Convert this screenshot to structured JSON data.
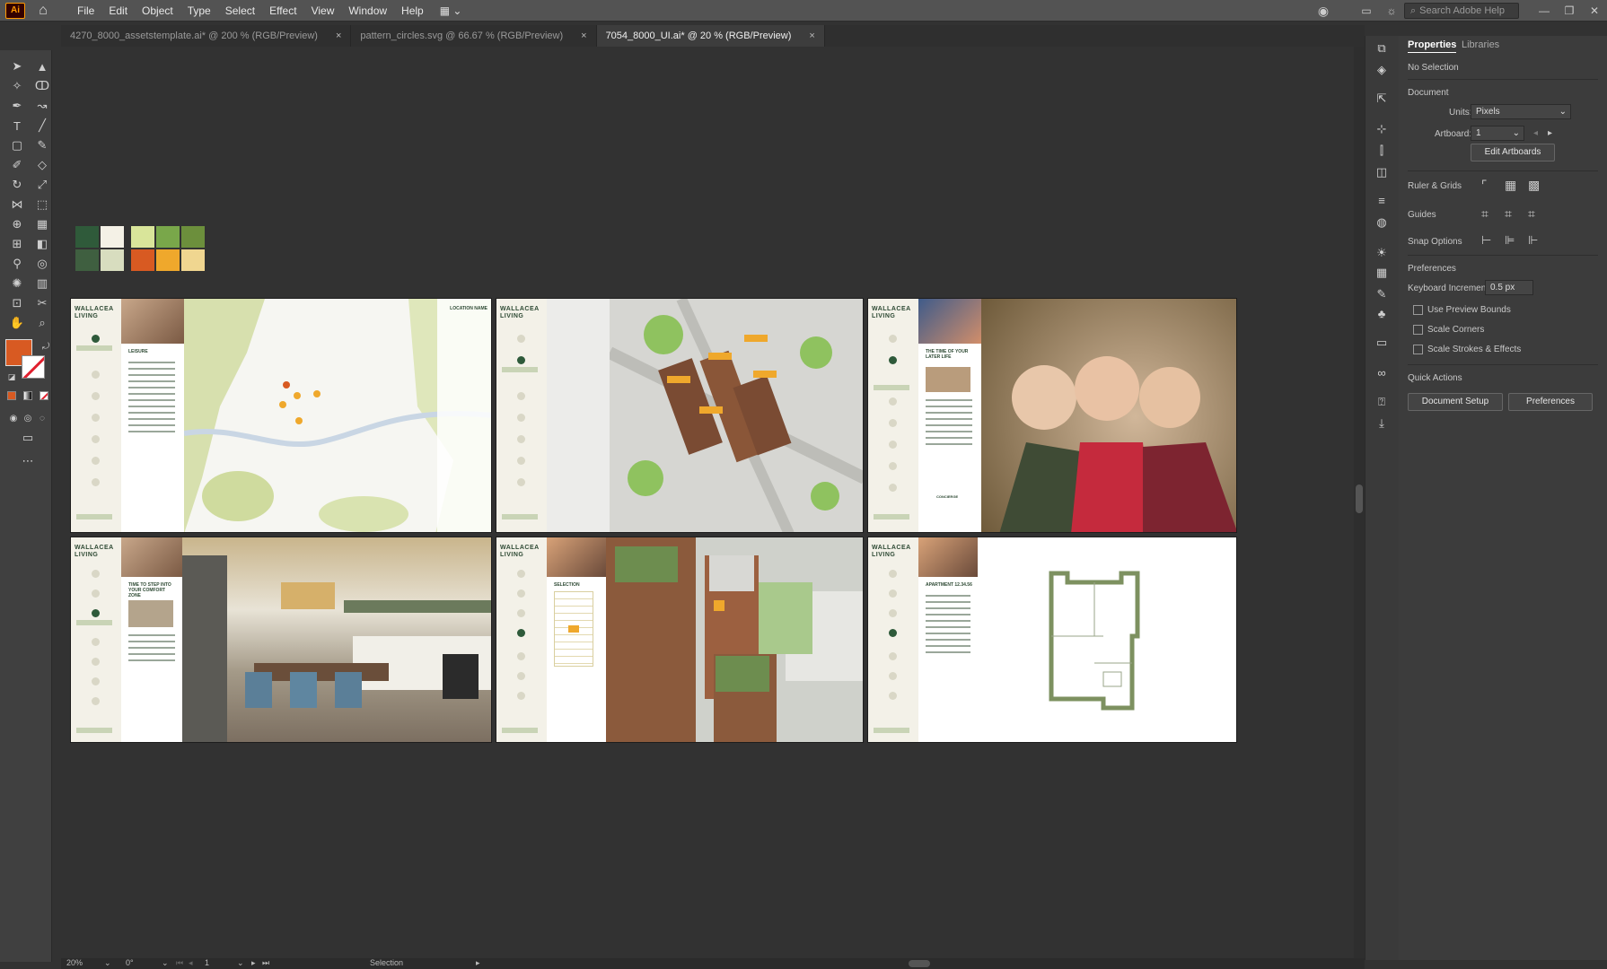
{
  "app": {
    "logo": "Ai",
    "workspace_icon": "▦ ⌄"
  },
  "menu": [
    "File",
    "Edit",
    "Object",
    "Type",
    "Select",
    "Effect",
    "View",
    "Window",
    "Help"
  ],
  "search": {
    "placeholder": "Search Adobe Help"
  },
  "tabs": [
    {
      "label": "4270_8000_assetstemplate.ai* @ 200 % (RGB/Preview)",
      "close": "×"
    },
    {
      "label": "pattern_circles.svg @ 66.67 % (RGB/Preview)",
      "close": "×"
    },
    {
      "label": "7054_8000_UI.ai* @ 20 % (RGB/Preview)",
      "close": "×"
    }
  ],
  "swatches": [
    "#2f5a3a",
    "#f4f1e6",
    "#d9e59a",
    "#79a74a",
    "#6c8f3c",
    "#3f5f40",
    "#d8ddbf",
    "#d85a22",
    "#efa82c",
    "#f0d690"
  ],
  "brand": {
    "logo_line1": "WALLACEA",
    "logo_line2": "LIVING"
  },
  "artboards": [
    {
      "heading": "LEISURE",
      "panel_title": "LOCATION NAME",
      "kind": "map"
    },
    {
      "heading": "",
      "kind": "aerial"
    },
    {
      "heading": "THE TIME OF YOUR LATER LIFE",
      "kind": "photo",
      "footer": "CONCIERGE"
    },
    {
      "heading": "TIME TO STEP INTO YOUR COMFORT ZONE",
      "kind": "kitchen"
    },
    {
      "heading": "SELECTION",
      "kind": "building"
    },
    {
      "heading": "APARTMENT 12.34.56",
      "kind": "floorplan"
    }
  ],
  "properties": {
    "tab_properties": "Properties",
    "tab_libraries": "Libraries",
    "no_selection": "No Selection",
    "document": "Document",
    "units_label": "Units:",
    "units_value": "Pixels",
    "artboard_label": "Artboard:",
    "artboard_value": "1",
    "edit_artboards": "Edit Artboards",
    "ruler_grids": "Ruler & Grids",
    "guides": "Guides",
    "snap_options": "Snap Options",
    "preferences": "Preferences",
    "keyboard_increment_label": "Keyboard Increment:",
    "keyboard_increment_value": "0.5 px",
    "use_preview_bounds": "Use Preview Bounds",
    "scale_corners": "Scale Corners",
    "scale_strokes": "Scale Strokes & Effects",
    "quick_actions": "Quick Actions",
    "document_setup": "Document Setup",
    "preferences_btn": "Preferences"
  },
  "status": {
    "zoom": "20%",
    "rotation": "0°",
    "artboard": "1",
    "tool": "Selection"
  },
  "colors": {
    "fill": "#d85a22",
    "accent_green": "#2e5a3a"
  }
}
